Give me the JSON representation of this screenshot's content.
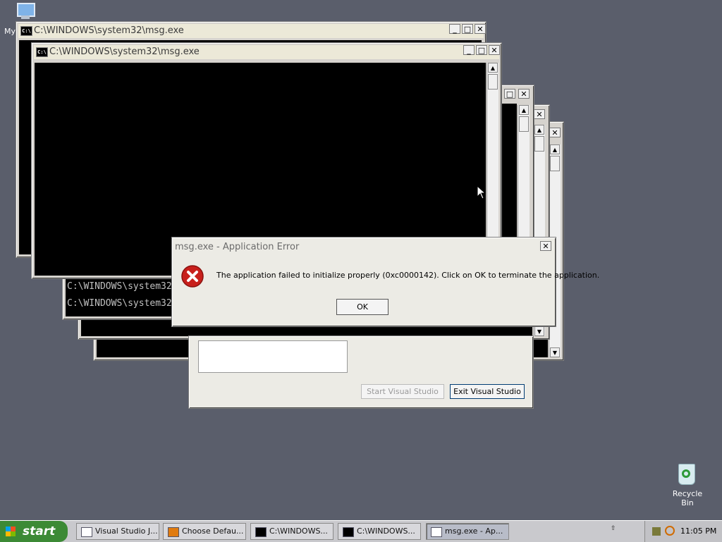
{
  "desktop": {
    "my_computer_label": "My",
    "recycle_bin_label": "Recycle Bin"
  },
  "console_windows": {
    "back_title": "C:\\WINDOWS\\system32\\msg.exe",
    "front_title": "C:\\WINDOWS\\system32\\msg.exe",
    "console_icon_text": "C:\\",
    "prompt_line_1": "C:\\WINDOWS\\system32",
    "prompt_line_2": "C:\\WINDOWS\\system32"
  },
  "vs_dialog": {
    "start_button": "Start Visual Studio",
    "exit_button": "Exit Visual Studio"
  },
  "error_dialog": {
    "title": "msg.exe - Application Error",
    "message": "The application failed to initialize properly (0xc0000142). Click on OK to terminate the application.",
    "ok_button": "OK",
    "close_glyph": "✕"
  },
  "taskbar": {
    "start_label": "start",
    "tasks": [
      {
        "label": "Visual Studio J...",
        "icon": "window-icon"
      },
      {
        "label": "Choose Defau...",
        "icon": "vs-icon"
      },
      {
        "label": "C:\\WINDOWS...",
        "icon": "console-icon"
      },
      {
        "label": "C:\\WINDOWS...",
        "icon": "console-icon"
      },
      {
        "label": "msg.exe - Ap...",
        "icon": "window-icon"
      }
    ],
    "clock": "11:05 PM"
  },
  "colors": {
    "desktop": "#5a5e6b",
    "start_button": "#3c8a35",
    "error_icon": "#c8201c"
  }
}
